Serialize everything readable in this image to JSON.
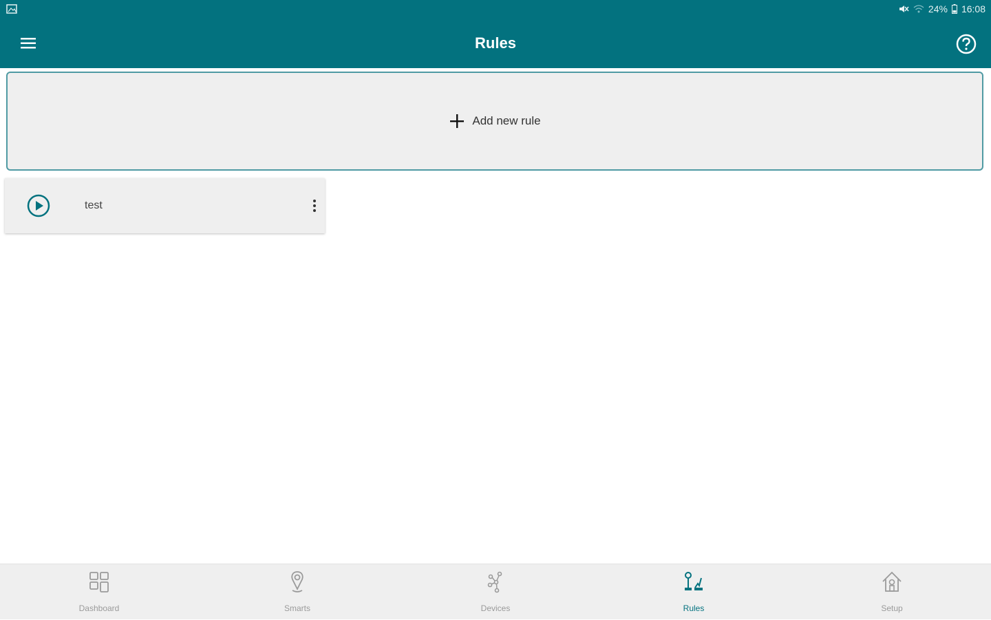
{
  "status_bar": {
    "battery": "24%",
    "time": "16:08"
  },
  "header": {
    "title": "Rules"
  },
  "add_rule": {
    "label": "Add new rule"
  },
  "rules": [
    {
      "name": "test"
    }
  ],
  "bottom_nav": [
    {
      "label": "Dashboard",
      "icon": "dashboard-icon",
      "active": false
    },
    {
      "label": "Smarts",
      "icon": "smarts-icon",
      "active": false
    },
    {
      "label": "Devices",
      "icon": "devices-icon",
      "active": false
    },
    {
      "label": "Rules",
      "icon": "rules-icon",
      "active": true
    },
    {
      "label": "Setup",
      "icon": "setup-icon",
      "active": false
    }
  ],
  "colors": {
    "primary": "#03727f",
    "background": "#ffffff",
    "card": "#efefef",
    "inactive": "#9a9a9a"
  }
}
